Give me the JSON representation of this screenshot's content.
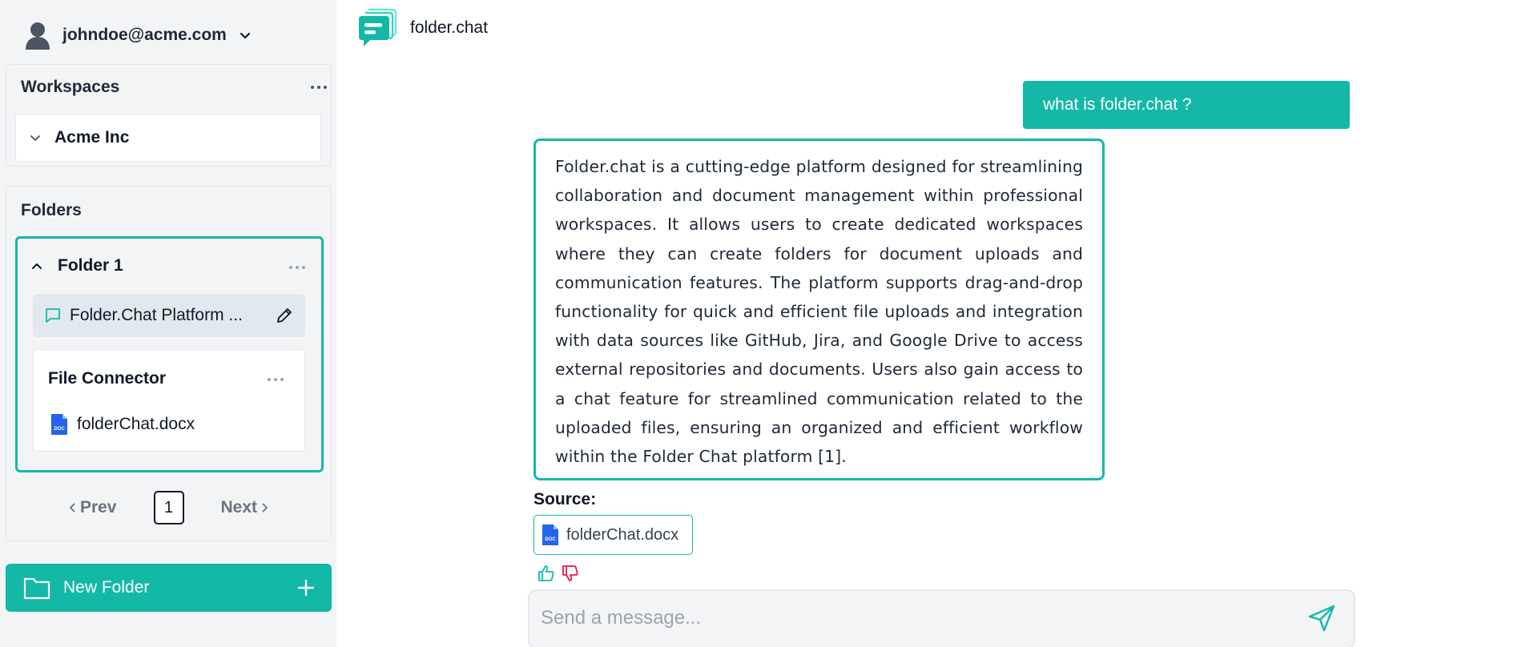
{
  "user": {
    "email": "johndoe@acme.com"
  },
  "workspaces": {
    "title": "Workspaces",
    "items": [
      {
        "label": "Acme Inc"
      }
    ]
  },
  "folders": {
    "title": "Folders",
    "folder": {
      "label": "Folder 1",
      "chat_label": "Folder.Chat Platform ...",
      "connector": {
        "title": "File Connector",
        "files": [
          {
            "name": "folderChat.docx",
            "icon": "docx-file-icon"
          }
        ]
      }
    },
    "pagination": {
      "prev": "Prev",
      "page": "1",
      "next": "Next"
    }
  },
  "new_folder_label": "New Folder",
  "brand": {
    "name": "folder.chat"
  },
  "conversation": {
    "user_message": "what is folder.chat ?",
    "assistant_message": "Folder.chat is a cutting-edge platform designed for streamlining collaboration and document management within professional workspaces. It allows users to create dedicated workspaces where they can create folders for document uploads and communication features. The platform supports drag-and-drop functionality for quick and efficient file uploads and integration with data sources like GitHub, Jira, and Google Drive to access external repositories and documents. Users also gain access to a chat feature for streamlined communication related to the uploaded files, ensuring an organized and efficient workflow within the Folder Chat platform [1].",
    "source_label": "Source:",
    "source_file": "folderChat.docx"
  },
  "composer": {
    "placeholder": "Send a message..."
  },
  "colors": {
    "accent": "#14b8a6",
    "sidebar_bg": "#f3f4f6",
    "thumbs_down": "#e11d48",
    "doc_icon": "#2563eb"
  }
}
